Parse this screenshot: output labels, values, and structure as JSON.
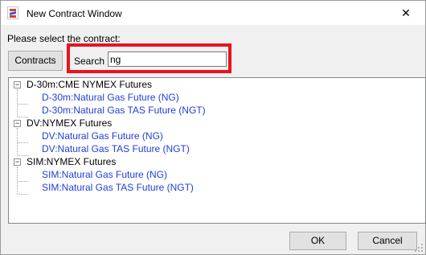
{
  "window": {
    "title": "New Contract Window",
    "close_glyph": "✕"
  },
  "prompt": "Please select the contract:",
  "contracts_button": "Contracts",
  "search": {
    "label": "Search",
    "value": "ng"
  },
  "tree": {
    "groups": [
      {
        "label": "D-30m:CME NYMEX Futures",
        "expander": "−",
        "items": [
          "D-30m:Natural Gas Future (NG)",
          "D-30m:Natural Gas TAS Future (NGT)"
        ]
      },
      {
        "label": "DV:NYMEX Futures",
        "expander": "−",
        "items": [
          "DV:Natural Gas Future (NG)",
          "DV:Natural Gas TAS Future (NGT)"
        ]
      },
      {
        "label": "SIM:NYMEX Futures",
        "expander": "−",
        "items": [
          "SIM:Natural Gas Future (NG)",
          "SIM:Natural Gas TAS Future (NGT)"
        ]
      }
    ]
  },
  "buttons": {
    "ok": "OK",
    "cancel": "Cancel"
  },
  "colors": {
    "highlight": "#e8141e",
    "leaf_text": "#1f3fd6"
  }
}
